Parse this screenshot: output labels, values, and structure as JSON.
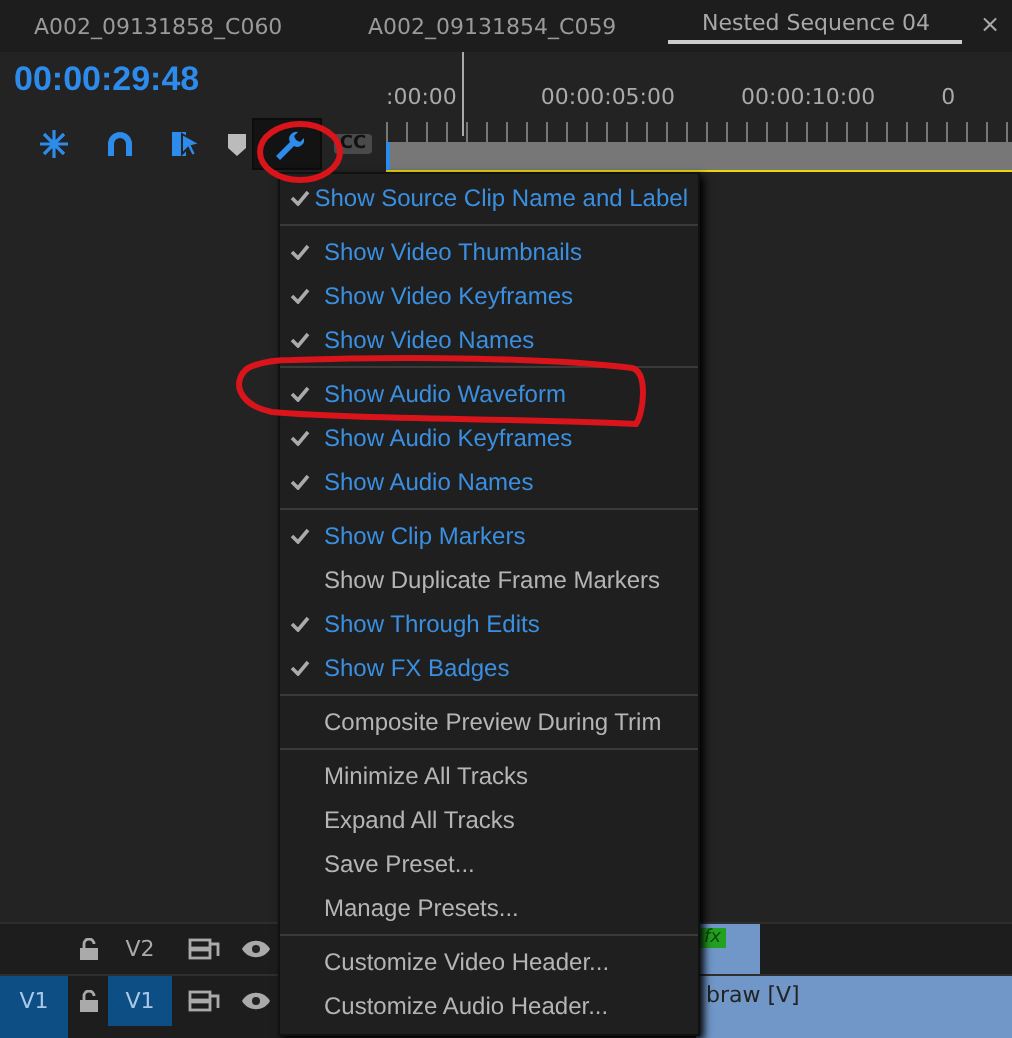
{
  "tabs": [
    {
      "label": "A002_09131858_C060",
      "selected": false
    },
    {
      "label": "A002_09131854_C059",
      "selected": false
    },
    {
      "label": "Nested Sequence 04",
      "selected": true
    }
  ],
  "close": "×",
  "timecode": "00:00:29:48",
  "ruler_labels": [
    ":00:00",
    "00:00:05:00",
    "00:00:10:00",
    "0"
  ],
  "toolbar": [
    {
      "kind": "snap",
      "selected": false
    },
    {
      "kind": "magnet",
      "selected": false
    },
    {
      "kind": "linked",
      "selected": false
    },
    {
      "kind": "marker",
      "selected": false
    },
    {
      "kind": "wrench",
      "selected": true
    },
    {
      "kind": "cc",
      "selected": false,
      "label": "CC"
    }
  ],
  "menu": [
    [
      {
        "label": "Show Source Clip Name and Label",
        "kind": "toggle",
        "checked": true
      }
    ],
    [
      {
        "label": "Show Video Thumbnails",
        "kind": "toggle",
        "checked": true
      },
      {
        "label": "Show Video Keyframes",
        "kind": "toggle",
        "checked": true
      },
      {
        "label": "Show Video Names",
        "kind": "toggle",
        "checked": true
      }
    ],
    [
      {
        "label": "Show Audio Waveform",
        "kind": "toggle",
        "checked": true
      },
      {
        "label": "Show Audio Keyframes",
        "kind": "toggle",
        "checked": true
      },
      {
        "label": "Show Audio Names",
        "kind": "toggle",
        "checked": true
      }
    ],
    [
      {
        "label": "Show Clip Markers",
        "kind": "toggle",
        "checked": true
      },
      {
        "label": "Show Duplicate Frame Markers",
        "kind": "toggle",
        "checked": false
      },
      {
        "label": "Show Through Edits",
        "kind": "toggle",
        "checked": true
      },
      {
        "label": "Show FX Badges",
        "kind": "toggle",
        "checked": true
      }
    ],
    [
      {
        "label": "Composite Preview During Trim",
        "kind": "command"
      }
    ],
    [
      {
        "label": "Minimize All Tracks",
        "kind": "command"
      },
      {
        "label": "Expand All Tracks",
        "kind": "command"
      },
      {
        "label": "Save Preset...",
        "kind": "command"
      },
      {
        "label": "Manage Presets...",
        "kind": "command"
      }
    ],
    [
      {
        "label": "Customize Video Header...",
        "kind": "command"
      },
      {
        "label": "Customize Audio Header...",
        "kind": "command"
      }
    ]
  ],
  "tracks": [
    {
      "label": "V2",
      "targeted": false,
      "badge": "fx"
    },
    {
      "source": "V1",
      "label": "V1",
      "targeted": true,
      "clip_text": "braw [V]"
    }
  ]
}
